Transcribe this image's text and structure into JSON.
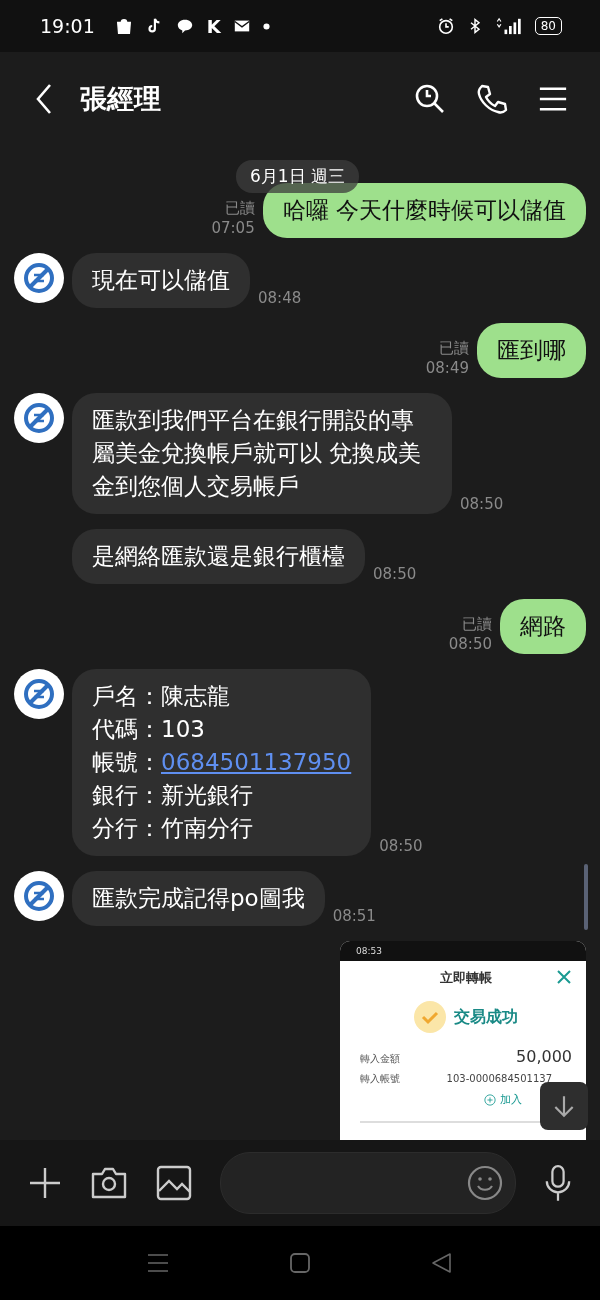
{
  "status_bar": {
    "time": "19:01",
    "app_letter": "K",
    "battery": "80"
  },
  "header": {
    "title": "張經理"
  },
  "date_pill": "6月1日 週三",
  "messages": [
    {
      "kind": "out",
      "text": "哈囉 今天什麼時候可以儲值",
      "read": "已讀",
      "time": "07:05"
    },
    {
      "kind": "in",
      "lines": [
        {
          "text": "現在可以儲值"
        }
      ],
      "time": "08:48",
      "continued": false
    },
    {
      "kind": "out",
      "text": "匯到哪",
      "read": "已讀",
      "time": "08:49"
    },
    {
      "kind": "in",
      "lines": [
        {
          "text": "匯款到我們平台在銀行開設的專屬美金兌換帳戶就可以 兌換成美金到您個人交易帳戶"
        }
      ],
      "time": "08:50",
      "continued": false
    },
    {
      "kind": "in",
      "lines": [
        {
          "text": "是網絡匯款還是銀行櫃檯"
        }
      ],
      "time": "08:50",
      "continued": true
    },
    {
      "kind": "out",
      "text": "網路",
      "read": "已讀",
      "time": "08:50"
    },
    {
      "kind": "in",
      "lines": [
        {
          "text": "戶名：陳志龍"
        },
        {
          "text": "代碼：103"
        },
        {
          "text": "帳號：",
          "link": "0684501137950"
        },
        {
          "text": "銀行：新光銀行"
        },
        {
          "text": "分行：竹南分行"
        }
      ],
      "time": "08:50",
      "continued": false
    },
    {
      "kind": "in",
      "lines": [
        {
          "text": "匯款完成記得po圖我"
        }
      ],
      "time": "08:51",
      "continued": false
    },
    {
      "kind": "image",
      "screenshot": {
        "time": "08:53",
        "title": "立即轉帳",
        "status": "交易成功",
        "rows": [
          {
            "label": "轉入金額",
            "value": "50,000",
            "kind": "amount"
          },
          {
            "label": "轉入帳號",
            "value": "103-0000684501137",
            "kind": "account"
          }
        ],
        "action": "加入"
      }
    }
  ]
}
